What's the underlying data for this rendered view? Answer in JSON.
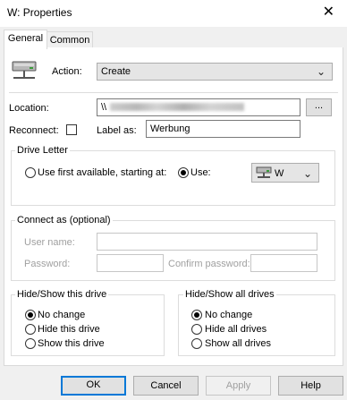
{
  "window": {
    "title": "W: Properties",
    "close_glyph": "✕"
  },
  "tabs": [
    {
      "label": "General",
      "active": true
    },
    {
      "label": "Common",
      "active": false
    }
  ],
  "action": {
    "label": "Action:",
    "value": "Create",
    "icon": "network-drive-icon"
  },
  "location": {
    "label": "Location:",
    "value": "\\\\",
    "browse_label": "..."
  },
  "reconnect": {
    "label": "Reconnect:",
    "checked": false
  },
  "label_as": {
    "label": "Label as:",
    "value": "Werbung"
  },
  "drive_letter": {
    "group_title": "Drive Letter",
    "option_first_available": "Use first available, starting at:",
    "option_use": "Use:",
    "selected": "use",
    "drive_value": "W"
  },
  "connect_as": {
    "group_title": "Connect as (optional)",
    "username_label": "User name:",
    "password_label": "Password:",
    "confirm_password_label": "Confirm password:"
  },
  "hide_show_drive": {
    "group_title": "Hide/Show this drive",
    "options": [
      "No change",
      "Hide this drive",
      "Show this drive"
    ],
    "selected_index": 0
  },
  "hide_show_all": {
    "group_title": "Hide/Show all drives",
    "options": [
      "No change",
      "Hide all drives",
      "Show all drives"
    ],
    "selected_index": 0
  },
  "buttons": {
    "ok": "OK",
    "cancel": "Cancel",
    "apply": "Apply",
    "help": "Help"
  }
}
